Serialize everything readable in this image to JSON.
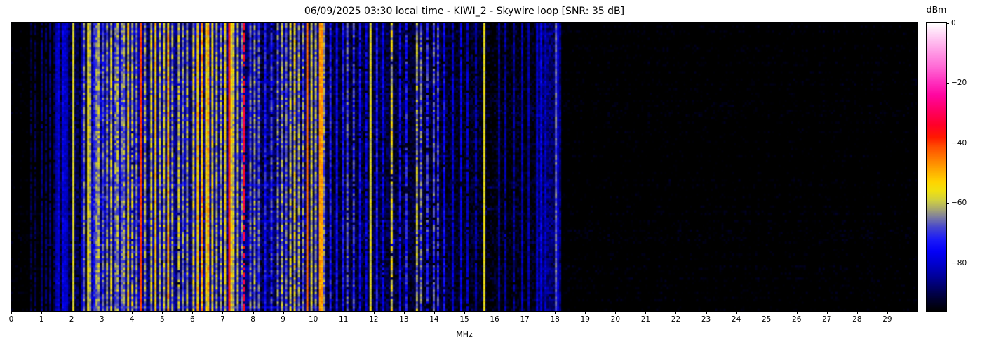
{
  "chart_data": {
    "type": "heatmap",
    "title": "06/09/2025 03:30 local time - KIWI_2 - Skywire loop [SNR: 35 dB]",
    "xlabel": "MHz",
    "ylabel": "",
    "x_range": [
      0,
      30
    ],
    "x_ticks": [
      0,
      1,
      2,
      3,
      4,
      5,
      6,
      7,
      8,
      9,
      10,
      11,
      12,
      13,
      14,
      15,
      16,
      17,
      18,
      19,
      20,
      21,
      22,
      23,
      24,
      25,
      26,
      27,
      28,
      29
    ],
    "grid": false,
    "legend": null,
    "colorbar": {
      "label": "dBm",
      "range": [
        0,
        -96
      ],
      "ticks": [
        {
          "value": 0,
          "label": "0"
        },
        {
          "value": -20,
          "label": "−20"
        },
        {
          "value": -40,
          "label": "−40"
        },
        {
          "value": -60,
          "label": "−60"
        },
        {
          "value": -80,
          "label": "−80"
        }
      ]
    },
    "colormap_stops_format": "[dBm_value, hex_color]",
    "colormap_stops": [
      [
        -96,
        "#000000"
      ],
      [
        -92,
        "#000030"
      ],
      [
        -88,
        "#000068"
      ],
      [
        -84,
        "#0000a0"
      ],
      [
        -80,
        "#0000d0"
      ],
      [
        -76,
        "#0400f8"
      ],
      [
        -72,
        "#1c1cf8"
      ],
      [
        -68,
        "#4848cc"
      ],
      [
        -65,
        "#7878a4"
      ],
      [
        -62,
        "#a8a870"
      ],
      [
        -59,
        "#d0d040"
      ],
      [
        -56,
        "#f0e010"
      ],
      [
        -53,
        "#ffd400"
      ],
      [
        -49,
        "#ffa800"
      ],
      [
        -45,
        "#ff7a00"
      ],
      [
        -41,
        "#ff4a00"
      ],
      [
        -38,
        "#ff1800"
      ],
      [
        -34,
        "#ff0028"
      ],
      [
        -29,
        "#ff0064"
      ],
      [
        -24,
        "#ff06a0"
      ],
      [
        -20,
        "#ff2cbc"
      ],
      [
        -15,
        "#ff66d4"
      ],
      [
        -10,
        "#ff96e4"
      ],
      [
        -5,
        "#ffc8f2"
      ],
      [
        0,
        "#ffffff"
      ]
    ],
    "noise_bands_format": "[f0_MHz, f1_MHz, mean_dBm, sigma_dB, line_prob, line_boost_min, line_boost_max]",
    "noise_bands": [
      [
        0,
        1.5,
        -93,
        2,
        0.1,
        2,
        5
      ],
      [
        1.5,
        2.25,
        -83,
        4,
        0.35,
        3,
        9
      ],
      [
        2.25,
        2.52,
        -89,
        3,
        0.15,
        2,
        6
      ],
      [
        2.52,
        8.25,
        -78.5,
        5,
        0.33,
        4,
        16
      ],
      [
        8.25,
        10.5,
        -81,
        5,
        0.3,
        4,
        14
      ],
      [
        10.5,
        14.5,
        -84,
        4.5,
        0.22,
        3,
        11
      ],
      [
        14.5,
        15.75,
        -86.5,
        4,
        0.18,
        3,
        8
      ],
      [
        15.75,
        17.4,
        -88,
        4,
        0.2,
        3,
        8
      ],
      [
        17.4,
        18.2,
        -81,
        4,
        0.3,
        3,
        8
      ],
      [
        18.2,
        30.01,
        -92.5,
        2.8,
        0.05,
        1,
        3
      ]
    ],
    "carriers_format": "[freq_MHz, level_dBm, duty_0to1, flutter_dB, width_bins(optional)]",
    "carriers": [
      [
        0.63,
        -88,
        0.35,
        3
      ],
      [
        0.79,
        -87,
        0.3,
        3
      ],
      [
        1.02,
        -84,
        0.45,
        3
      ],
      [
        1.16,
        -85,
        0.4,
        3
      ],
      [
        1.31,
        -84,
        0.45,
        3
      ],
      [
        1.44,
        -86,
        0.35,
        3
      ],
      [
        1.52,
        -78,
        0.7,
        4
      ],
      [
        1.6,
        -75,
        0.75,
        4
      ],
      [
        1.69,
        -74,
        0.8,
        4
      ],
      [
        1.78,
        -76,
        0.7,
        4
      ],
      [
        1.88,
        -77,
        0.65,
        4
      ],
      [
        2.05,
        -56,
        1,
        2
      ],
      [
        2.31,
        -78,
        0.5,
        5
      ],
      [
        2.44,
        -61,
        0.6,
        6
      ],
      [
        2.56,
        -53,
        0.95,
        4
      ],
      [
        2.64,
        -57,
        0.85,
        5
      ],
      [
        2.73,
        -66,
        0.7,
        6
      ],
      [
        2.84,
        -59,
        0.6,
        6
      ],
      [
        2.93,
        -56,
        0.6,
        6
      ],
      [
        3.03,
        -62,
        0.55,
        6
      ],
      [
        3.17,
        -57,
        0.55,
        7
      ],
      [
        3.33,
        -54,
        0.7,
        7
      ],
      [
        3.42,
        -59,
        0.5,
        7
      ],
      [
        3.53,
        -56,
        0.5,
        7
      ],
      [
        3.66,
        -61,
        0.5,
        6
      ],
      [
        3.76,
        -57,
        0.5,
        7
      ],
      [
        3.88,
        -49,
        0.5,
        8
      ],
      [
        3.99,
        -54,
        0.45,
        7
      ],
      [
        4.12,
        -59,
        0.5,
        6
      ],
      [
        4.29,
        -38,
        1,
        2
      ],
      [
        4.45,
        -57,
        0.5,
        7
      ],
      [
        4.61,
        -54,
        0.5,
        7
      ],
      [
        4.77,
        -47,
        0.65,
        7
      ],
      [
        4.93,
        -56,
        0.5,
        6
      ],
      [
        5.07,
        -54,
        0.5,
        7
      ],
      [
        5.22,
        -45,
        0.7,
        7
      ],
      [
        5.37,
        -57,
        0.5,
        7
      ],
      [
        5.52,
        -54,
        0.45,
        7
      ],
      [
        5.7,
        -59,
        0.5,
        6
      ],
      [
        5.85,
        -56,
        0.5,
        7
      ],
      [
        6.02,
        -53,
        0.55,
        7
      ],
      [
        6.17,
        -47,
        0.75,
        7
      ],
      [
        6.31,
        -43,
        0.8,
        7
      ],
      [
        6.43,
        -49,
        0.6,
        7
      ],
      [
        6.55,
        -45,
        0.7,
        7
      ],
      [
        6.67,
        -51,
        0.6,
        7
      ],
      [
        6.82,
        -55,
        0.5,
        7
      ],
      [
        6.96,
        -57,
        0.5,
        6
      ],
      [
        7.09,
        -51,
        0.6,
        7
      ],
      [
        7.19,
        -36,
        1,
        2
      ],
      [
        7.31,
        -51,
        0.85,
        6
      ],
      [
        7.39,
        -54,
        0.7,
        6
      ],
      [
        7.48,
        -56,
        0.6,
        6
      ],
      [
        7.61,
        -59,
        0.5,
        6
      ],
      [
        7.74,
        -29,
        0.22,
        4
      ],
      [
        7.91,
        -61,
        0.5,
        6
      ],
      [
        8.06,
        -57,
        0.5,
        7
      ],
      [
        8.21,
        -62,
        0.45,
        6
      ],
      [
        8.42,
        -68,
        0.5,
        6
      ],
      [
        8.63,
        -64,
        0.45,
        6
      ],
      [
        8.82,
        -59,
        0.5,
        7
      ],
      [
        8.98,
        -56,
        0.6,
        7
      ],
      [
        9.11,
        -61,
        0.5,
        6
      ],
      [
        9.23,
        -54,
        0.75,
        8
      ],
      [
        9.36,
        -49,
        0.55,
        9
      ],
      [
        9.51,
        -57,
        0.5,
        7
      ],
      [
        9.66,
        -59,
        0.5,
        7
      ],
      [
        9.8,
        -42,
        1,
        2
      ],
      [
        9.95,
        -55,
        0.85,
        5
      ],
      [
        10.07,
        -57,
        0.65,
        6
      ],
      [
        10.2,
        -45,
        0.95,
        3,
        2
      ],
      [
        10.36,
        -59,
        0.6,
        6
      ],
      [
        10.56,
        -67,
        0.5,
        6
      ],
      [
        10.76,
        -71,
        0.5,
        5
      ],
      [
        10.96,
        -69,
        0.5,
        5
      ],
      [
        11.16,
        -63,
        0.45,
        6
      ],
      [
        11.36,
        -65,
        0.4,
        6
      ],
      [
        11.56,
        -71,
        0.45,
        5
      ],
      [
        11.76,
        -73,
        0.4,
        5
      ],
      [
        11.88,
        -55,
        0.95,
        3
      ],
      [
        12.11,
        -69,
        0.5,
        5
      ],
      [
        12.32,
        -73,
        0.4,
        5
      ],
      [
        12.62,
        -51,
        0.42,
        8
      ],
      [
        12.86,
        -71,
        0.4,
        5
      ],
      [
        13.11,
        -67,
        0.4,
        6
      ],
      [
        13.4,
        -55,
        0.5,
        8
      ],
      [
        13.59,
        -61,
        0.5,
        7
      ],
      [
        13.76,
        -65,
        0.4,
        6
      ],
      [
        13.96,
        -63,
        0.45,
        6
      ],
      [
        14.11,
        -65,
        0.4,
        6
      ],
      [
        14.36,
        -71,
        0.4,
        5
      ],
      [
        14.62,
        -76,
        0.4,
        4
      ],
      [
        14.87,
        -74,
        0.4,
        4
      ],
      [
        15.12,
        -77,
        0.4,
        4
      ],
      [
        15.38,
        -79,
        0.4,
        4
      ],
      [
        15.64,
        -55,
        0.97,
        2
      ],
      [
        16.12,
        -81,
        0.5,
        4
      ],
      [
        16.38,
        -80,
        0.45,
        4
      ],
      [
        16.62,
        -82,
        0.4,
        4
      ],
      [
        16.91,
        -78,
        0.6,
        4
      ],
      [
        17.16,
        -80,
        0.5,
        4
      ],
      [
        17.42,
        -76,
        0.6,
        4
      ],
      [
        17.52,
        -74,
        0.65,
        4
      ],
      [
        17.72,
        -77,
        0.6,
        4
      ],
      [
        18.0,
        -63,
        0.85,
        4
      ],
      [
        18.1,
        -76,
        0.6,
        4
      ]
    ],
    "streaks_format": "[row_fraction, f0_MHz, f1_MHz, boost_dB] — horizontal broadband time events",
    "streaks": [
      [
        0.205,
        2.3,
        9.6,
        12
      ],
      [
        0.205,
        9.6,
        14.3,
        5
      ],
      [
        0.232,
        1.15,
        10.5,
        7
      ],
      [
        0.335,
        2.4,
        8.3,
        10
      ],
      [
        0.402,
        2.5,
        7.2,
        9
      ],
      [
        0.47,
        2.4,
        6,
        8
      ],
      [
        0.56,
        2.3,
        10.4,
        13
      ],
      [
        0.56,
        10.4,
        13.8,
        5
      ],
      [
        0.573,
        15.78,
        16.1,
        11
      ],
      [
        0.605,
        2.4,
        9,
        9
      ],
      [
        0.649,
        15.8,
        16.15,
        12
      ],
      [
        0.685,
        2.3,
        9.3,
        12
      ],
      [
        0.685,
        9.3,
        13.5,
        4
      ],
      [
        0.77,
        1.2,
        8.5,
        10
      ],
      [
        0.8,
        2.5,
        6.5,
        8
      ],
      [
        0.885,
        2.4,
        9,
        9
      ],
      [
        0.955,
        2.3,
        7.8,
        9
      ],
      [
        0.988,
        2.3,
        10.4,
        16
      ]
    ],
    "patches_format": "[f0_MHz, f1_MHz, row_frac0, row_frac1, boost_dB] — fuzzy strong blobs",
    "patches": [
      [
        2.95,
        3.65,
        0.1,
        0.17,
        12
      ],
      [
        2.85,
        3.75,
        0.26,
        0.34,
        14
      ],
      [
        3.05,
        3.6,
        0.45,
        0.53,
        11
      ],
      [
        6.05,
        7.55,
        0,
        0.05,
        8
      ],
      [
        2.6,
        3.45,
        0.6,
        0.66,
        10
      ],
      [
        12.56,
        12.7,
        0.6,
        0.82,
        16
      ],
      [
        9.15,
        9.45,
        0.28,
        0.42,
        7
      ]
    ],
    "render": {
      "bins": 430,
      "rows": 120,
      "seed": 11
    }
  }
}
